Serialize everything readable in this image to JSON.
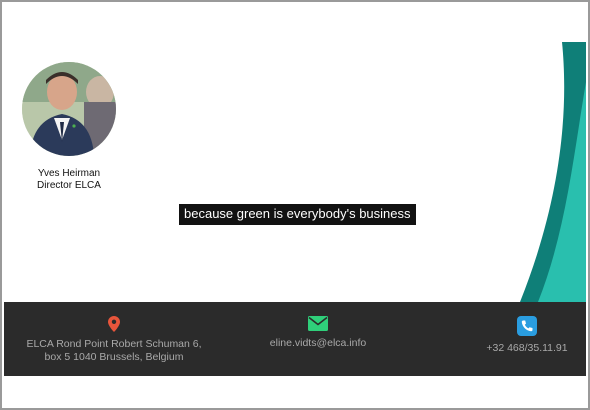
{
  "person": {
    "name": "Yves Heirman",
    "role": "Director ELCA"
  },
  "caption": "because green is everybody's business",
  "footer": {
    "address_line1": "ELCA Rond Point Robert Schuman 6,",
    "address_line2": "box 5 1040 Brussels, Belgium",
    "email": "eline.vidts@elca.info",
    "phone": "+32 468/35.11.91"
  },
  "icons": {
    "location": "location-pin-icon",
    "email": "envelope-icon",
    "phone": "phone-icon"
  },
  "colors": {
    "teal_dark": "#0f7f78",
    "teal_light": "#2cc6b4",
    "footer_bg": "#2b2b2b",
    "location_icon": "#e8553b",
    "email_icon": "#2fcf7a",
    "phone_icon": "#2a9de0"
  }
}
